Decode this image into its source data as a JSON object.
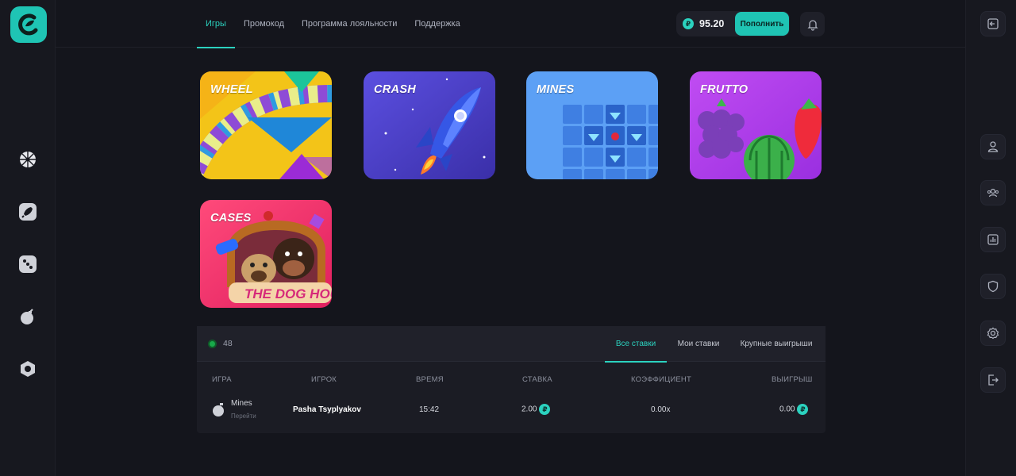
{
  "header": {
    "tabs": [
      {
        "label": "Игры"
      },
      {
        "label": "Промокод"
      },
      {
        "label": "Программа лояльности"
      },
      {
        "label": "Поддержка"
      }
    ],
    "balance": "95.20",
    "currency_symbol": "₽",
    "deposit_label": "Пополнить"
  },
  "left_nav": [
    {
      "icon": "wheel-icon"
    },
    {
      "icon": "rocket-icon"
    },
    {
      "icon": "dice-icon"
    },
    {
      "icon": "bomb-icon"
    },
    {
      "icon": "hexagon-icon"
    }
  ],
  "right_nav": [
    {
      "icon": "login-icon"
    },
    {
      "icon": "user-icon"
    },
    {
      "icon": "users-icon"
    },
    {
      "icon": "stats-icon"
    },
    {
      "icon": "shield-icon"
    },
    {
      "icon": "settings-icon"
    },
    {
      "icon": "logout-icon"
    }
  ],
  "games": [
    {
      "title": "WHEEL"
    },
    {
      "title": "CRASH"
    },
    {
      "title": "MINES"
    },
    {
      "title": "FRUTTO"
    },
    {
      "title": "CASES",
      "banner": "THE DOG HOUSE"
    }
  ],
  "bets": {
    "online_count": "48",
    "tabs": [
      {
        "label": "Все ставки"
      },
      {
        "label": "Мои ставки"
      },
      {
        "label": "Крупные выигрыши"
      }
    ],
    "columns": [
      "ИГРА",
      "ИГРОК",
      "ВРЕМЯ",
      "СТАВКА",
      "КОЭФФИЦИЕНТ",
      "ВЫИГРЫШ"
    ],
    "rows": [
      {
        "game": "Mines",
        "game_link": "Перейти",
        "player": "Pasha Tsyplyakov",
        "time": "15:42",
        "bet": "2.00",
        "coefficient": "0.00x",
        "win": "0.00"
      }
    ]
  },
  "colors": {
    "accent": "#2bd2bf",
    "background": "#14151c",
    "online": "#18a94a"
  }
}
